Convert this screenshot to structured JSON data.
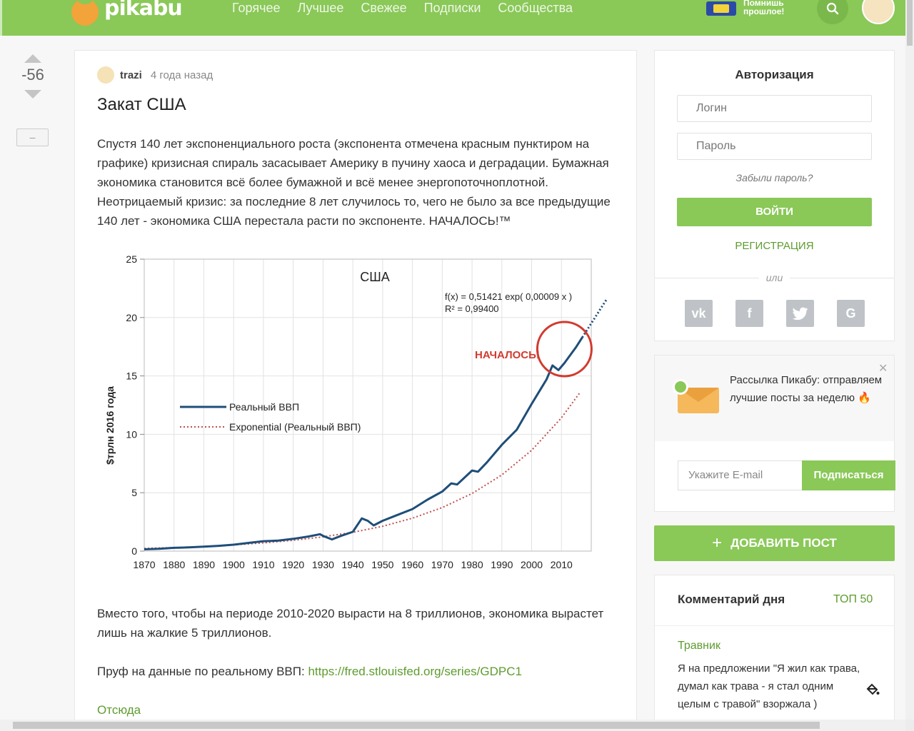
{
  "header": {
    "logo_text": "pikabu",
    "nav": [
      "Горячее",
      "Лучшее",
      "Свежее",
      "Подписки",
      "Сообщества"
    ],
    "promo_text": "Помнишь\nпрошлое!",
    "search_icon": "search-icon"
  },
  "vote": {
    "count": "-56",
    "collapse_label": "–"
  },
  "story": {
    "author": "trazi",
    "time": "4 года назад",
    "title": "Закат США",
    "paragraph1": "Спустя 140 лет экспоненциального роста (экспонента отмечена красным пунктиром на графике) кризисная спираль засасывает Америку в пучину хаоса и деградации. Бумажная экономика становится всё более бумажной и всё менее энергопоточноплотной. Неотрицаемый кризис: за последние 8 лет случилось то, чего не было за все предыдущие 140 лет - экономика США перестала расти по экспоненте. НАЧАЛОСЬ!™",
    "paragraph2": "Вместо того, чтобы на периоде 2010-2020 вырасти на 8 триллионов, экономика вырастет лишь на жалкие 5 триллионов.",
    "proof_label": "Пруф на данные по реальному ВВП: ",
    "proof_link": "https://fred.stlouisfed.org/series/GDPC1",
    "source_link": "Отсюда"
  },
  "chart_data": {
    "type": "line",
    "title": "США",
    "xlabel": "",
    "ylabel": "$трлн 2016 года",
    "xlim": [
      1870,
      2020
    ],
    "ylim": [
      0,
      25
    ],
    "x_ticks": [
      "1870",
      "1880",
      "1890",
      "1900",
      "1910",
      "1920",
      "1930",
      "1940",
      "1950",
      "1960",
      "1970",
      "1980",
      "1990",
      "2000",
      "2010"
    ],
    "y_ticks": [
      "0",
      "5",
      "10",
      "15",
      "20",
      "25"
    ],
    "grid": true,
    "legend_position": "left",
    "formula": "f(x) = 0,51421 exp( 0,00009 x )",
    "r_squared": "R² = 0,99400",
    "annotation": "НАЧАЛОСЬ!",
    "highlight_circle_center": [
      2011,
      17.3
    ],
    "series": [
      {
        "name": "Реальный ВВП",
        "color": "#1f4e79",
        "style": "solid",
        "x": [
          1870,
          1875,
          1880,
          1885,
          1890,
          1895,
          1900,
          1905,
          1910,
          1915,
          1920,
          1925,
          1929,
          1930,
          1933,
          1936,
          1940,
          1943,
          1945,
          1947,
          1950,
          1955,
          1960,
          1965,
          1970,
          1973,
          1975,
          1980,
          1982,
          1985,
          1990,
          1995,
          2000,
          2005,
          2007,
          2009,
          2011,
          2015,
          2017
        ],
        "values": [
          0.15,
          0.2,
          0.28,
          0.32,
          0.38,
          0.45,
          0.55,
          0.7,
          0.85,
          0.9,
          1.05,
          1.25,
          1.45,
          1.3,
          1.0,
          1.3,
          1.65,
          2.8,
          2.6,
          2.2,
          2.6,
          3.1,
          3.6,
          4.4,
          5.1,
          5.8,
          5.7,
          6.9,
          6.8,
          7.6,
          9.1,
          10.4,
          12.6,
          14.7,
          15.9,
          15.5,
          16.1,
          17.5,
          18.3
        ]
      },
      {
        "name": "Exponential (Реальный ВВП)",
        "color": "#c0504d",
        "style": "dotted",
        "x": [
          1870,
          1880,
          1890,
          1900,
          1910,
          1920,
          1930,
          1940,
          1950,
          1960,
          1970,
          1980,
          1990,
          2000,
          2010,
          2016
        ],
        "values": [
          0.23,
          0.3,
          0.4,
          0.53,
          0.7,
          0.92,
          1.22,
          1.61,
          2.13,
          2.82,
          3.73,
          4.93,
          6.52,
          8.63,
          11.42,
          13.5
        ]
      },
      {
        "name": "",
        "color": "#1f4e79",
        "style": "dotted",
        "x": [
          2017,
          2025
        ],
        "values": [
          18.3,
          21.5
        ]
      }
    ]
  },
  "auth": {
    "title": "Авторизация",
    "login_placeholder": "Логин",
    "password_placeholder": "Пароль",
    "forgot": "Забыли пароль?",
    "login_button": "ВОЙТИ",
    "register": "РЕГИСТРАЦИЯ",
    "or": "или",
    "social": [
      "vk-icon",
      "facebook-icon",
      "twitter-icon",
      "google-icon"
    ]
  },
  "newsletter": {
    "text": "Рассылка Пикабу: отправляем лучшие посты за неделю",
    "email_placeholder": "Укажите E-mail",
    "subscribe_button": "Подписаться"
  },
  "add_post": {
    "label": "ДОБАВИТЬ ПОСТ"
  },
  "comment_of_day": {
    "title": "Комментарий дня",
    "top_link": "ТОП 50",
    "user": "Травник",
    "text": "Я на предложении \"Я жил как трава, думал как трава - я стал одним целым с травой\" взоржала )"
  },
  "colors": {
    "brand": "#8ac858",
    "link": "#5e9c2f"
  }
}
